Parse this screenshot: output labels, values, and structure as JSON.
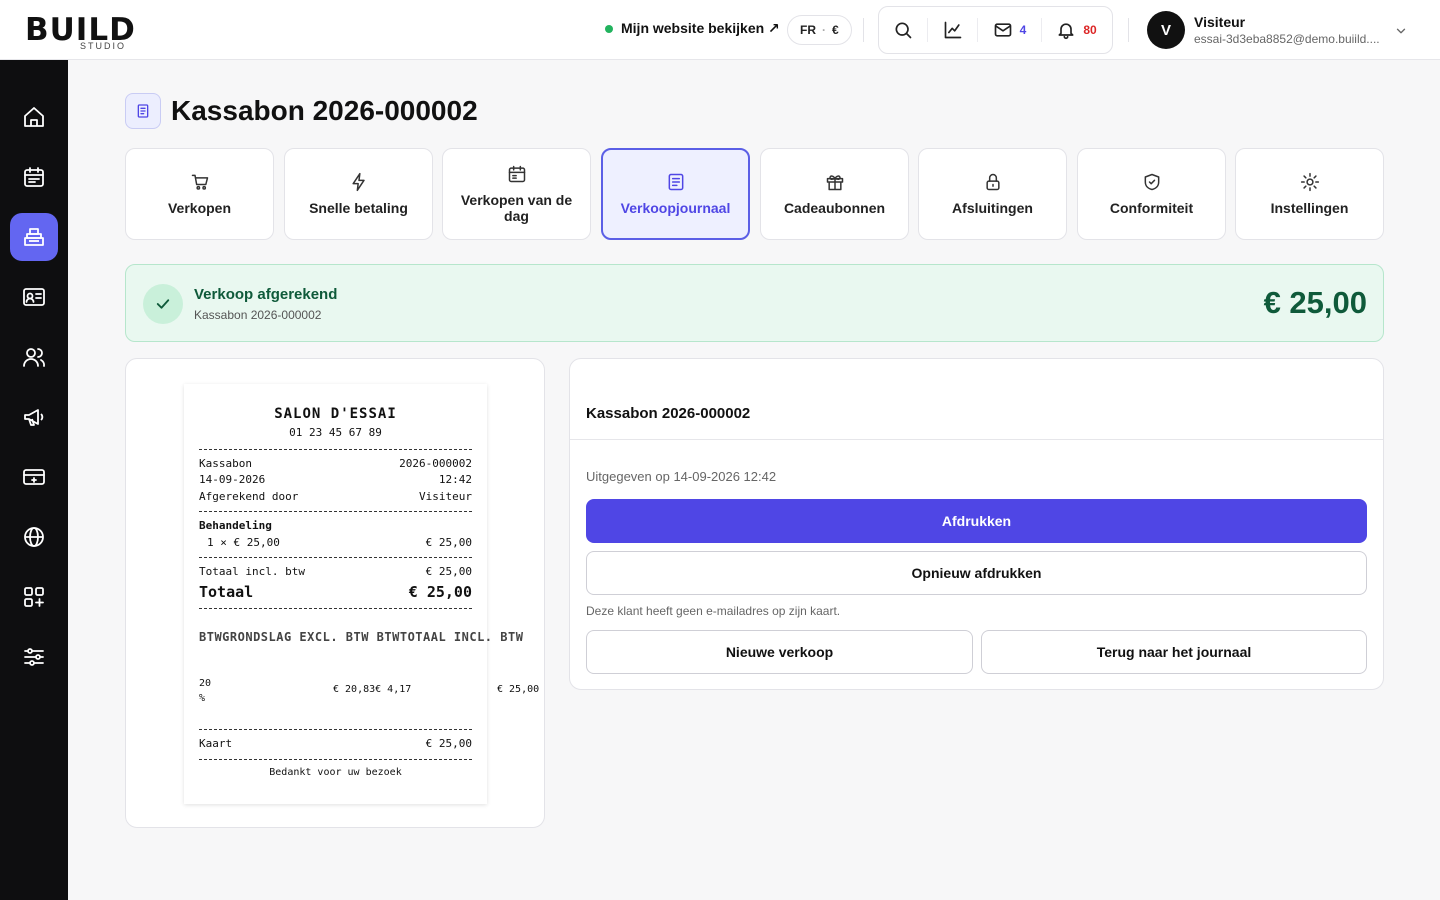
{
  "brand": {
    "logo_text": "BUILD",
    "logo_sub": "STUDIO"
  },
  "topbar": {
    "site_link": "Mijn website bekijken ↗",
    "lang": "FR",
    "currency": "€",
    "mail_count": "4",
    "notif_count": "80",
    "user_initial": "V",
    "user_name": "Visiteur",
    "user_email": "essai-3d3eba8852@demo.buiild...."
  },
  "sidebar": {
    "items": [
      {
        "icon": "home-icon"
      },
      {
        "icon": "calendar-icon"
      },
      {
        "icon": "register-icon",
        "active": true
      },
      {
        "icon": "contact-card-icon"
      },
      {
        "icon": "users-icon"
      },
      {
        "icon": "megaphone-icon"
      },
      {
        "icon": "payment-terminal-icon"
      },
      {
        "icon": "globe-icon"
      },
      {
        "icon": "apps-icon"
      },
      {
        "icon": "sliders-icon"
      }
    ]
  },
  "page": {
    "title": "Kassabon 2026-000002"
  },
  "tabs": [
    {
      "label": "Verkopen",
      "icon": "cart-icon"
    },
    {
      "label": "Snelle betaling",
      "icon": "bolt-icon"
    },
    {
      "label": "Verkopen van de dag",
      "icon": "calendar-icon"
    },
    {
      "label": "Verkoopjournaal",
      "icon": "document-icon",
      "active": true
    },
    {
      "label": "Cadeaubonnen",
      "icon": "gift-icon"
    },
    {
      "label": "Afsluitingen",
      "icon": "lock-icon"
    },
    {
      "label": "Conformiteit",
      "icon": "shield-check-icon"
    },
    {
      "label": "Instellingen",
      "icon": "sun-gear-icon"
    }
  ],
  "success": {
    "title": "Verkoop afgerekend",
    "subtitle": "Kassabon 2026-000002",
    "amount": "€ 25,00"
  },
  "receipt": {
    "shop_name": "SALON D'ESSAI",
    "phone": "01 23 45 67 89",
    "ticket_label": "Kassabon",
    "ticket_number": "2026-000002",
    "date": "14-09-2026",
    "time": "12:42",
    "cashier_label": "Afgerekend door",
    "cashier": "Visiteur",
    "section": "Behandeling",
    "line_qty": "1 × € 25,00",
    "line_amount": "€ 25,00",
    "total_incl_label": "Totaal incl. btw",
    "total_incl": "€ 25,00",
    "total_label": "Totaal",
    "total": "€ 25,00",
    "vat_header": "BTWGRONDSLAG EXCL. BTW BTWTOTAAL INCL. BTW",
    "vat_rate": "20 %",
    "vat_base_amount": "€ 20,83€ 4,17",
    "vat_incl": "€ 25,00",
    "payment_label": "Kaart",
    "payment_amount": "€ 25,00",
    "thanks": "Bedankt voor uw bezoek"
  },
  "details": {
    "title": "Kassabon 2026-000002",
    "issued": "Uitgegeven op 14-09-2026 12:42",
    "print_label": "Afdrukken",
    "reprint_label": "Opnieuw afdrukken",
    "note": "Deze klant heeft geen e-mailadres op zijn kaart.",
    "new_sale_label": "Nieuwe verkoop",
    "back_label": "Terug naar het journaal"
  },
  "colors": {
    "accent": "#4f46e5",
    "sidebar_bg": "#0e0e10",
    "sidebar_active": "#6366f1",
    "success_bg": "#e9f8f0",
    "success_text": "#0f5a3a",
    "notif_red": "#dc2626"
  }
}
